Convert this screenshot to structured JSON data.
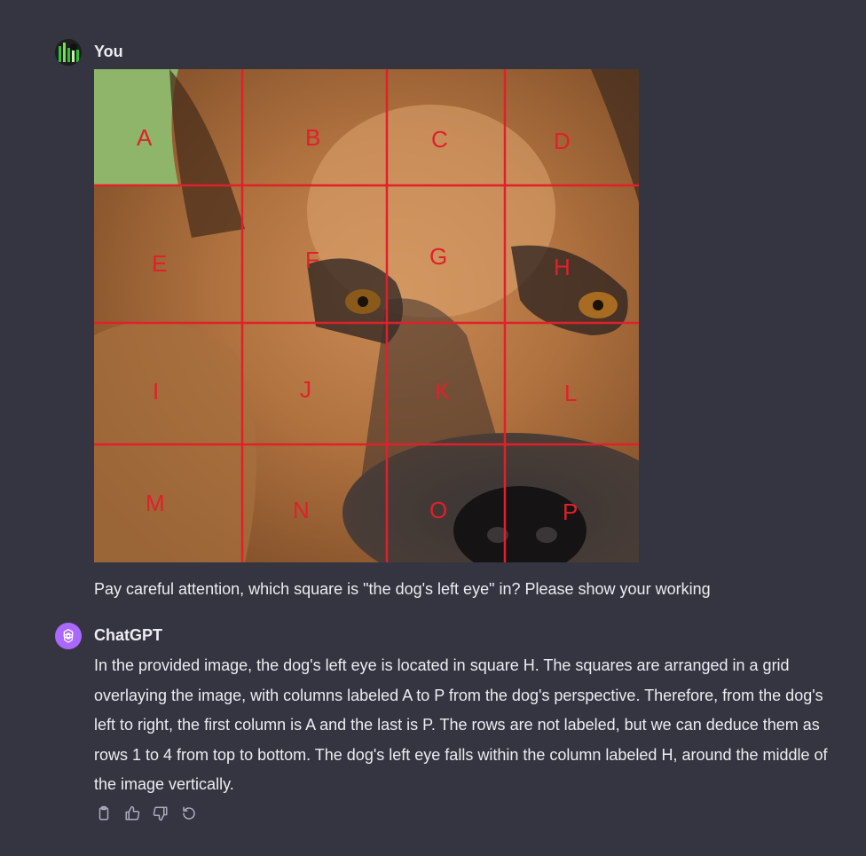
{
  "conversation": {
    "user_message": {
      "author": "You",
      "avatar_icon": "user-avatar",
      "image": {
        "grid_labels": [
          "A",
          "B",
          "C",
          "D",
          "E",
          "F",
          "G",
          "H",
          "I",
          "J",
          "K",
          "L",
          "M",
          "N",
          "O",
          "P"
        ],
        "grid_line_color": "#e0202a"
      },
      "text": "Pay careful attention, which square is \"the dog's left eye\" in? Please show your working"
    },
    "assistant_message": {
      "author": "ChatGPT",
      "avatar_icon": "openai-logo-icon",
      "avatar_color": "#ab68ff",
      "text": "In the provided image, the dog's left eye is located in square H. The squares are arranged in a grid overlaying the image, with columns labeled A to P from the dog's perspective. Therefore, from the dog's left to right, the first column is A and the last is P. The rows are not labeled, but we can deduce them as rows 1 to 4 from top to bottom. The dog's left eye falls within the column labeled H, around the middle of the image vertically.",
      "actions": [
        "copy-icon",
        "thumbs-up-icon",
        "thumbs-down-icon",
        "regenerate-icon"
      ]
    }
  }
}
